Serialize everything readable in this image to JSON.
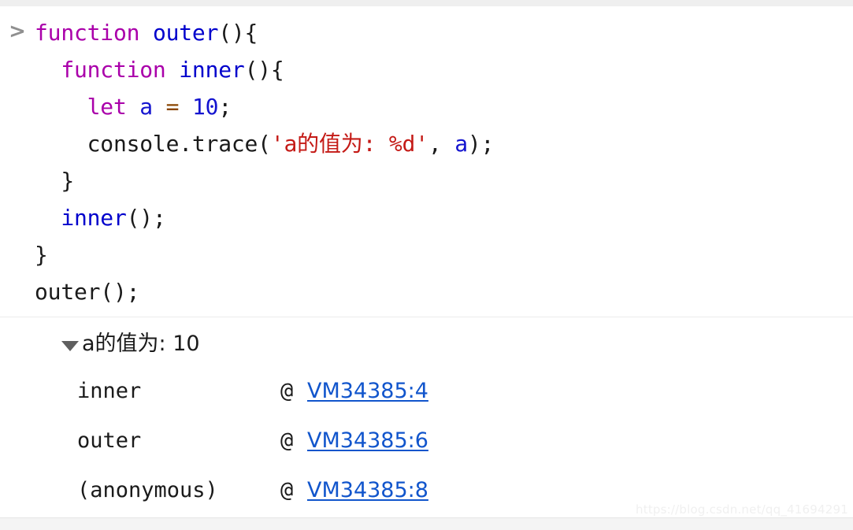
{
  "window": {
    "app": "Chrome DevTools Console",
    "prompt_symbol": ">"
  },
  "input": {
    "lines": [
      {
        "indent": 0,
        "tokens": [
          {
            "type": "keyword",
            "text": "function"
          },
          {
            "type": "plain",
            "text": " "
          },
          {
            "type": "fnname",
            "text": "outer"
          },
          {
            "type": "plain",
            "text": "(){"
          }
        ]
      },
      {
        "indent": 1,
        "tokens": [
          {
            "type": "keyword",
            "text": "function"
          },
          {
            "type": "plain",
            "text": " "
          },
          {
            "type": "fnname",
            "text": "inner"
          },
          {
            "type": "plain",
            "text": "(){"
          }
        ]
      },
      {
        "indent": 2,
        "tokens": [
          {
            "type": "keyword",
            "text": "let"
          },
          {
            "type": "plain",
            "text": " "
          },
          {
            "type": "var",
            "text": "a"
          },
          {
            "type": "plain",
            "text": " "
          },
          {
            "type": "operator",
            "text": "="
          },
          {
            "type": "plain",
            "text": " "
          },
          {
            "type": "number",
            "text": "10"
          },
          {
            "type": "plain",
            "text": ";"
          }
        ]
      },
      {
        "indent": 2,
        "tokens": [
          {
            "type": "plain",
            "text": "console.trace("
          },
          {
            "type": "string",
            "text": "'a的值为: %d'"
          },
          {
            "type": "plain",
            "text": ", "
          },
          {
            "type": "var",
            "text": "a"
          },
          {
            "type": "plain",
            "text": ");"
          }
        ]
      },
      {
        "indent": 1,
        "tokens": [
          {
            "type": "plain",
            "text": "}"
          }
        ]
      },
      {
        "indent": 1,
        "tokens": [
          {
            "type": "fnname",
            "text": "inner"
          },
          {
            "type": "plain",
            "text": "();"
          }
        ]
      },
      {
        "indent": 0,
        "tokens": [
          {
            "type": "plain",
            "text": "}"
          }
        ]
      },
      {
        "indent": 0,
        "tokens": [
          {
            "type": "plain",
            "text": "outer();"
          }
        ]
      }
    ]
  },
  "output": {
    "trace_message": "a的值为: 10",
    "expanded": true,
    "at_symbol": "@",
    "stack": [
      {
        "function": "inner",
        "location": "VM34385:4"
      },
      {
        "function": "outer",
        "location": "VM34385:6"
      },
      {
        "function": "(anonymous)",
        "location": "VM34385:8"
      }
    ]
  },
  "watermark": {
    "text": "https://blog.csdn.net/qq_41694291"
  },
  "colors": {
    "keyword": "#aa00aa",
    "function_name": "#0000cc",
    "number": "#1414cf",
    "operator": "#8a4500",
    "string": "#c41a16",
    "link": "#1155cc",
    "text": "#1a1a1a",
    "prompt": "#8f8f8f"
  }
}
